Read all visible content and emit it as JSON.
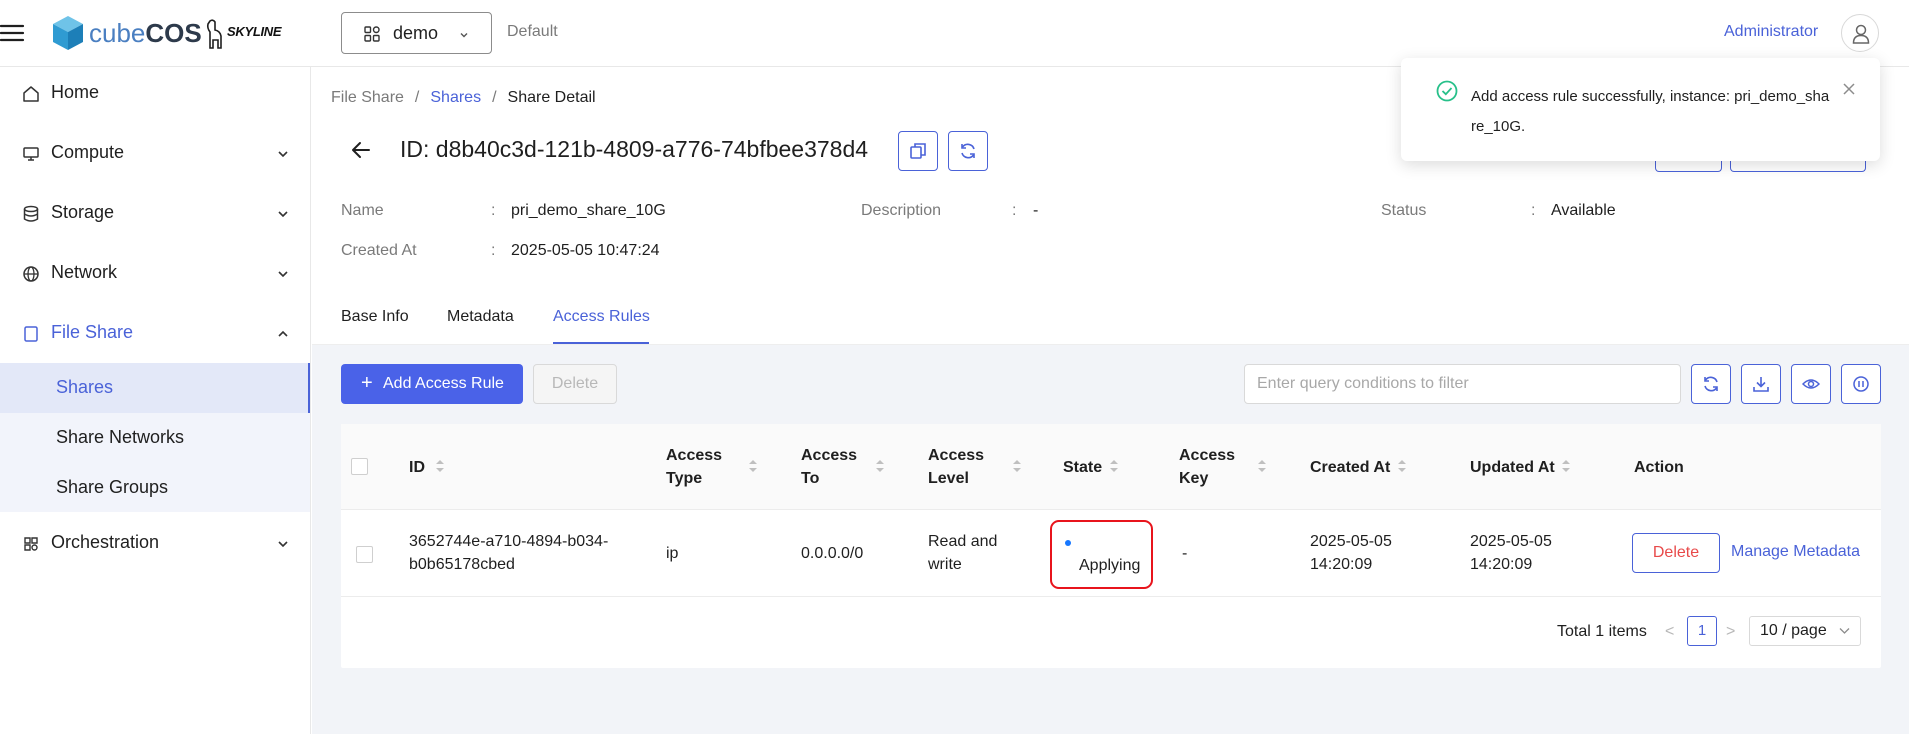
{
  "header": {
    "logo_prefix": "cube",
    "logo_suffix": "COS",
    "skyline_label": "SKYLINE",
    "project_name": "demo",
    "domain_name": "Default",
    "user_name": "Administrator"
  },
  "sidebar": {
    "items": [
      {
        "label": "Home",
        "icon": "home-icon"
      },
      {
        "label": "Compute",
        "icon": "monitor-icon"
      },
      {
        "label": "Storage",
        "icon": "database-icon"
      },
      {
        "label": "Network",
        "icon": "globe-icon"
      },
      {
        "label": "File Share",
        "icon": "file-icon"
      },
      {
        "label": "Orchestration",
        "icon": "gear-icon"
      }
    ],
    "file_share_sub": [
      {
        "label": "Shares"
      },
      {
        "label": "Share Networks"
      },
      {
        "label": "Share Groups"
      }
    ]
  },
  "breadcrumb": {
    "items": [
      "File Share",
      "Shares",
      "Share Detail"
    ],
    "separator": "/"
  },
  "detail": {
    "id_label": "ID:",
    "id_value": "d8b40c3d-121b-4809-a776-74bfbee378d4",
    "name_label": "Name",
    "name_value": "pri_demo_share_10G",
    "description_label": "Description",
    "description_value": "-",
    "status_label": "Status",
    "status_value": "Available",
    "created_label": "Created At",
    "created_value": "2025-05-05 10:47:24",
    "colon": ":"
  },
  "tabs": [
    {
      "label": "Base Info"
    },
    {
      "label": "Metadata"
    },
    {
      "label": "Access Rules",
      "active": true
    }
  ],
  "toolbar": {
    "add_label": "Add Access Rule",
    "add_plus": "+",
    "delete_label": "Delete",
    "search_placeholder": "Enter query conditions to filter"
  },
  "table": {
    "columns": [
      "ID",
      "Access Type",
      "Access To",
      "Access Level",
      "State",
      "Access Key",
      "Created At",
      "Updated At",
      "Action"
    ],
    "rows": [
      {
        "id": "3652744e-a710-4894-b034-b0b65178cbed",
        "access_type": "ip",
        "access_to": "0.0.0.0/0",
        "access_level": "Read and write",
        "state": "Applying",
        "access_key": "-",
        "created_at": "2025-05-05 14:20:09",
        "updated_at": "2025-05-05 14:20:09",
        "action_delete": "Delete",
        "action_manage": "Manage Metadata"
      }
    ]
  },
  "pagination": {
    "total": "Total 1 items",
    "current_page": "1",
    "page_size": "10 / page",
    "prev": "<",
    "next": ">"
  },
  "toast": {
    "message": "Add access rule successfully, instance: pri_demo_share_10G."
  },
  "colors": {
    "accent": "#4a62d8",
    "danger": "#e84a4a",
    "success": "#27c08a",
    "highlight": "#e8141c"
  }
}
